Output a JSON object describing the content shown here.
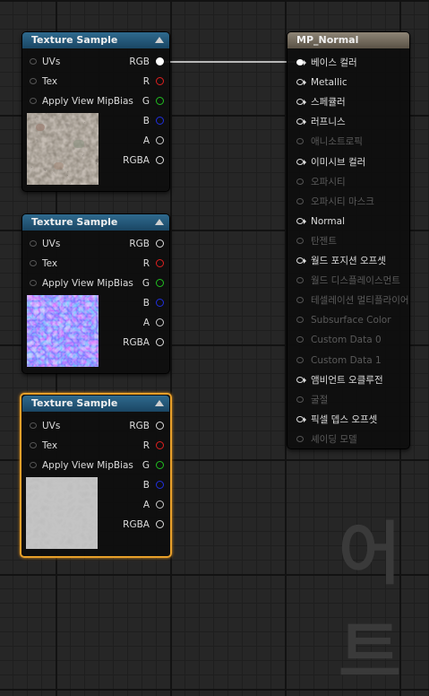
{
  "texture_nodes": [
    {
      "title": "Texture Sample",
      "inputs": [
        "UVs",
        "Tex",
        "Apply View MipBias"
      ],
      "outputs": [
        "RGB",
        "R",
        "G",
        "B",
        "A",
        "RGBA"
      ],
      "preview": "rock-base-color"
    },
    {
      "title": "Texture Sample",
      "inputs": [
        "UVs",
        "Tex",
        "Apply View MipBias"
      ],
      "outputs": [
        "RGB",
        "R",
        "G",
        "B",
        "A",
        "RGBA"
      ],
      "preview": "rock-normal-map"
    },
    {
      "title": "Texture Sample",
      "inputs": [
        "UVs",
        "Tex",
        "Apply View MipBias"
      ],
      "outputs": [
        "RGB",
        "R",
        "G",
        "B",
        "A",
        "RGBA"
      ],
      "preview": "rock-grayscale"
    }
  ],
  "material_node": {
    "title": "MP_Normal",
    "pins": [
      {
        "label": "베이스 컬러",
        "active": true
      },
      {
        "label": "Metallic",
        "active": true
      },
      {
        "label": "스페큘러",
        "active": true
      },
      {
        "label": "러프니스",
        "active": true
      },
      {
        "label": "애니소트로픽",
        "active": false
      },
      {
        "label": "이미시브 컬러",
        "active": true
      },
      {
        "label": "오파시티",
        "active": false
      },
      {
        "label": "오파시티 마스크",
        "active": false
      },
      {
        "label": "Normal",
        "active": true
      },
      {
        "label": "탄젠트",
        "active": false
      },
      {
        "label": "월드 포지션 오프셋",
        "active": true
      },
      {
        "label": "월드 디스플레이스먼트",
        "active": false
      },
      {
        "label": "테셀레이션 멀티플라이어",
        "active": false
      },
      {
        "label": "Subsurface Color",
        "active": false
      },
      {
        "label": "Custom Data 0",
        "active": false
      },
      {
        "label": "Custom Data 1",
        "active": false
      },
      {
        "label": "앰비언트 오클루전",
        "active": true
      },
      {
        "label": "굴절",
        "active": false
      },
      {
        "label": "픽셀 뎁스 오프셋",
        "active": true
      },
      {
        "label": "셰이딩 모델",
        "active": false
      }
    ]
  },
  "channel_colors": {
    "RGB": "#ffffff",
    "R": "#e02020",
    "G": "#20c020",
    "B": "#2030e0",
    "A": "#cccccc",
    "RGBA": "#ffffff"
  },
  "watermark": "어트"
}
